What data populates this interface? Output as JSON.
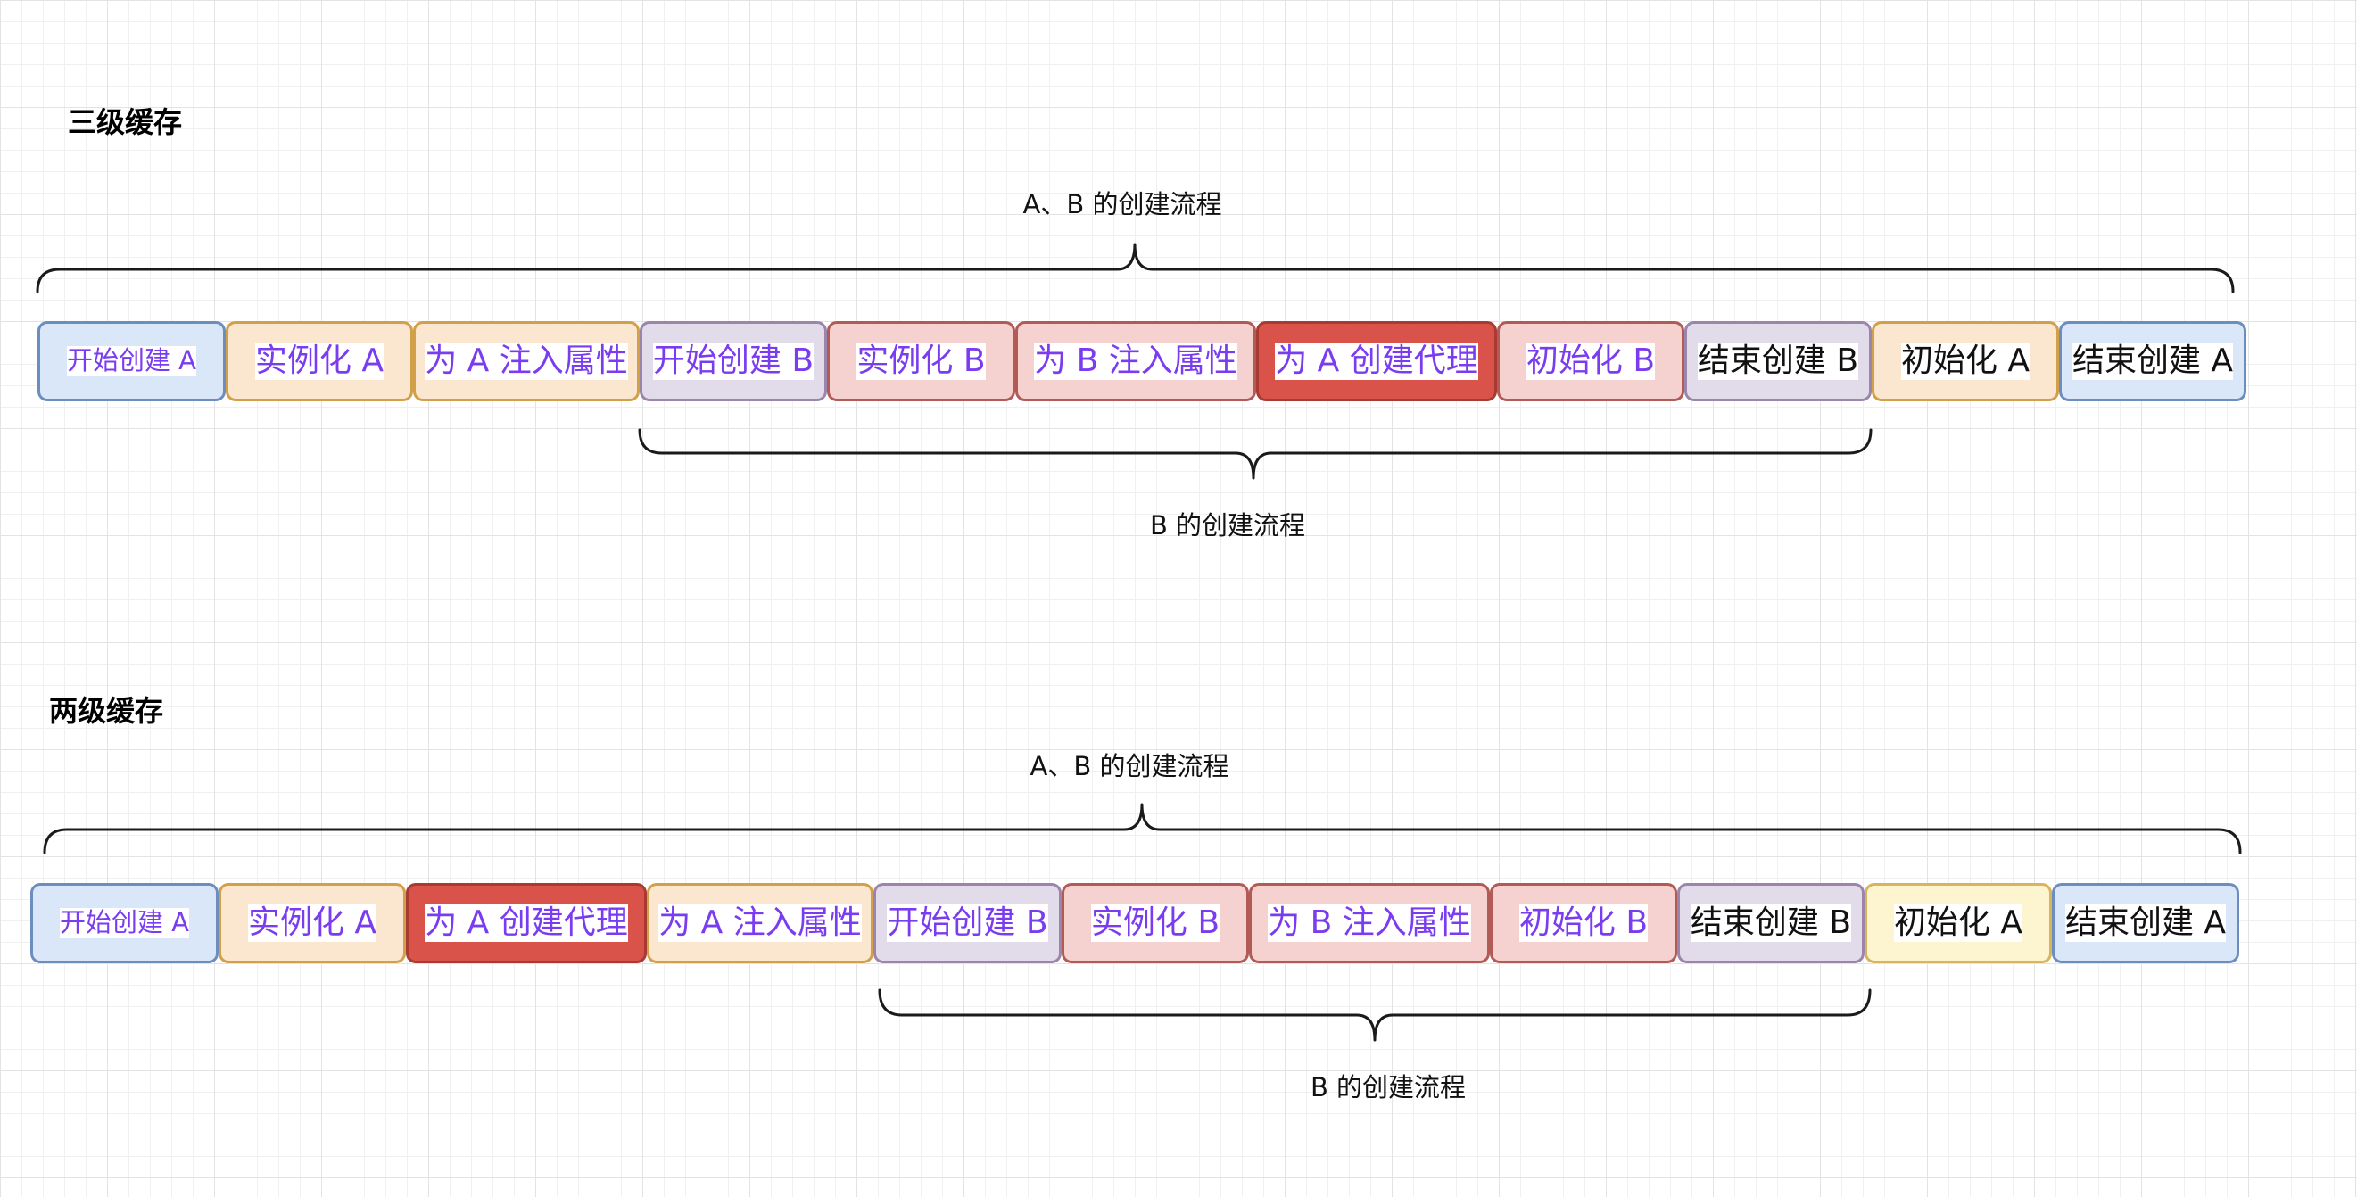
{
  "sections": [
    {
      "title": "三级缓存",
      "top_brace_label": "A、B 的创建流程",
      "bottom_brace_label": "B 的创建流程",
      "steps": [
        {
          "label": "开始创建 A",
          "color": "blue"
        },
        {
          "label": "实例化 A",
          "color": "orange"
        },
        {
          "label": "为 A 注入属性",
          "color": "orange"
        },
        {
          "label": "开始创建 B",
          "color": "purple"
        },
        {
          "label": "实例化 B",
          "color": "pink"
        },
        {
          "label": "为 B 注入属性",
          "color": "pink"
        },
        {
          "label": "为 A 创建代理",
          "color": "red"
        },
        {
          "label": "初始化 B",
          "color": "pink"
        },
        {
          "label": "结束创建 B",
          "color": "purple"
        },
        {
          "label": "初始化 A",
          "color": "orange"
        },
        {
          "label": "结束创建 A",
          "color": "blue"
        }
      ]
    },
    {
      "title": "两级缓存",
      "top_brace_label": "A、B 的创建流程",
      "bottom_brace_label": "B 的创建流程",
      "steps": [
        {
          "label": "开始创建 A",
          "color": "blue"
        },
        {
          "label": "实例化 A",
          "color": "orange"
        },
        {
          "label": "为 A 创建代理",
          "color": "red"
        },
        {
          "label": "为 A 注入属性",
          "color": "orange"
        },
        {
          "label": "开始创建 B",
          "color": "purple"
        },
        {
          "label": "实例化 B",
          "color": "pink"
        },
        {
          "label": "为 B 注入属性",
          "color": "pink"
        },
        {
          "label": "初始化 B",
          "color": "pink"
        },
        {
          "label": "结束创建 B",
          "color": "purple"
        },
        {
          "label": "初始化 A",
          "color": "yellow"
        },
        {
          "label": "结束创建 A",
          "color": "blue"
        }
      ]
    }
  ],
  "colors": {
    "blue": "#dae7f8",
    "orange": "#fbe6cf",
    "purple": "#e2dbea",
    "pink": "#f5d2d0",
    "red": "#d9534a",
    "yellow": "#fdf4d0",
    "label_purple": "#7a3cf0",
    "label_black": "#111111"
  }
}
